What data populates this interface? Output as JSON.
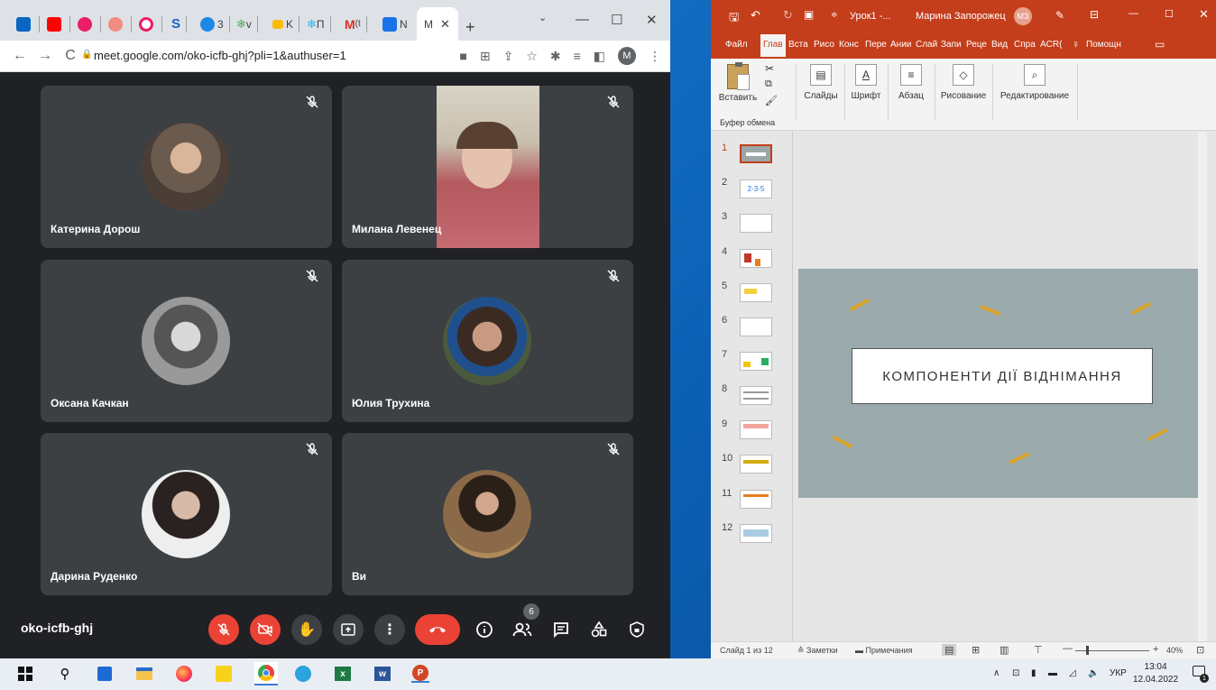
{
  "browser": {
    "tabs": [
      {
        "label": "",
        "color": "#0a66c2"
      },
      {
        "label": "",
        "color": "#ff0000"
      },
      {
        "label": "",
        "color": "#e91e63"
      },
      {
        "label": "",
        "color": "#f28b82"
      },
      {
        "label": "",
        "color": "#e91e63"
      },
      {
        "label": "S",
        "color": "#1565c0"
      },
      {
        "label": "3",
        "color": "#1e88e5"
      },
      {
        "label": "v",
        "color": "#4caf50"
      },
      {
        "label": "K",
        "color": "#fbbc04"
      },
      {
        "label": "П",
        "color": "#29b6f6"
      },
      {
        "label": "(t",
        "color": "#d93025"
      },
      {
        "label": "N",
        "color": "#1a73e8"
      }
    ],
    "active_tab_label": "M",
    "url": "meet.google.com/oko-icfb-ghj?pli=1&authuser=1",
    "profile_initial": "M"
  },
  "meet": {
    "participants": [
      {
        "name": "Катерина Дорош",
        "photo_bg": "#6b5b4f"
      },
      {
        "name": "Милана Левенец",
        "photo_bg": "#b45a5f"
      },
      {
        "name": "Оксана Качкан",
        "photo_bg": "#888888"
      },
      {
        "name": "Юлия Трухина",
        "photo_bg": "#4a5a3e"
      },
      {
        "name": "Дарина Руденко",
        "photo_bg": "#222222"
      },
      {
        "name": "Ви",
        "photo_bg": "#7a5a3a"
      }
    ],
    "meeting_code": "oko-icfb-ghj",
    "participants_count": "6"
  },
  "powerpoint": {
    "title": "Урок1 -...",
    "user_name": "Марина Запорожец",
    "user_initials": "МЗ",
    "ribbon_tabs": [
      "Файл",
      "Глав",
      "Вста",
      "Рисо",
      "Конс",
      "Пере",
      "Ании",
      "Слай",
      "Запи",
      "Реце",
      "Вид",
      "Спра",
      "ACR(",
      "Помощн"
    ],
    "ribbon_groups": [
      "Вставить",
      "Слайды",
      "Шрифт",
      "Абзац",
      "Рисование",
      "Редактирование"
    ],
    "clipboard_label": "Буфер обмена",
    "slide_numbers": [
      "1",
      "2",
      "3",
      "4",
      "5",
      "6",
      "7",
      "8",
      "9",
      "10",
      "11",
      "12"
    ],
    "slide_title": "КОМПОНЕНТИ ДІЇ ВІДНІМАННЯ",
    "status": {
      "slide_of": "Слайд 1 из 12",
      "notes": "Заметки",
      "comments": "Примечания",
      "zoom": "40%"
    },
    "accent_color": "#c43e1c"
  },
  "taskbar": {
    "language": "УКР",
    "time": "13:04",
    "date": "12.04.2022",
    "notification_count": "1"
  }
}
